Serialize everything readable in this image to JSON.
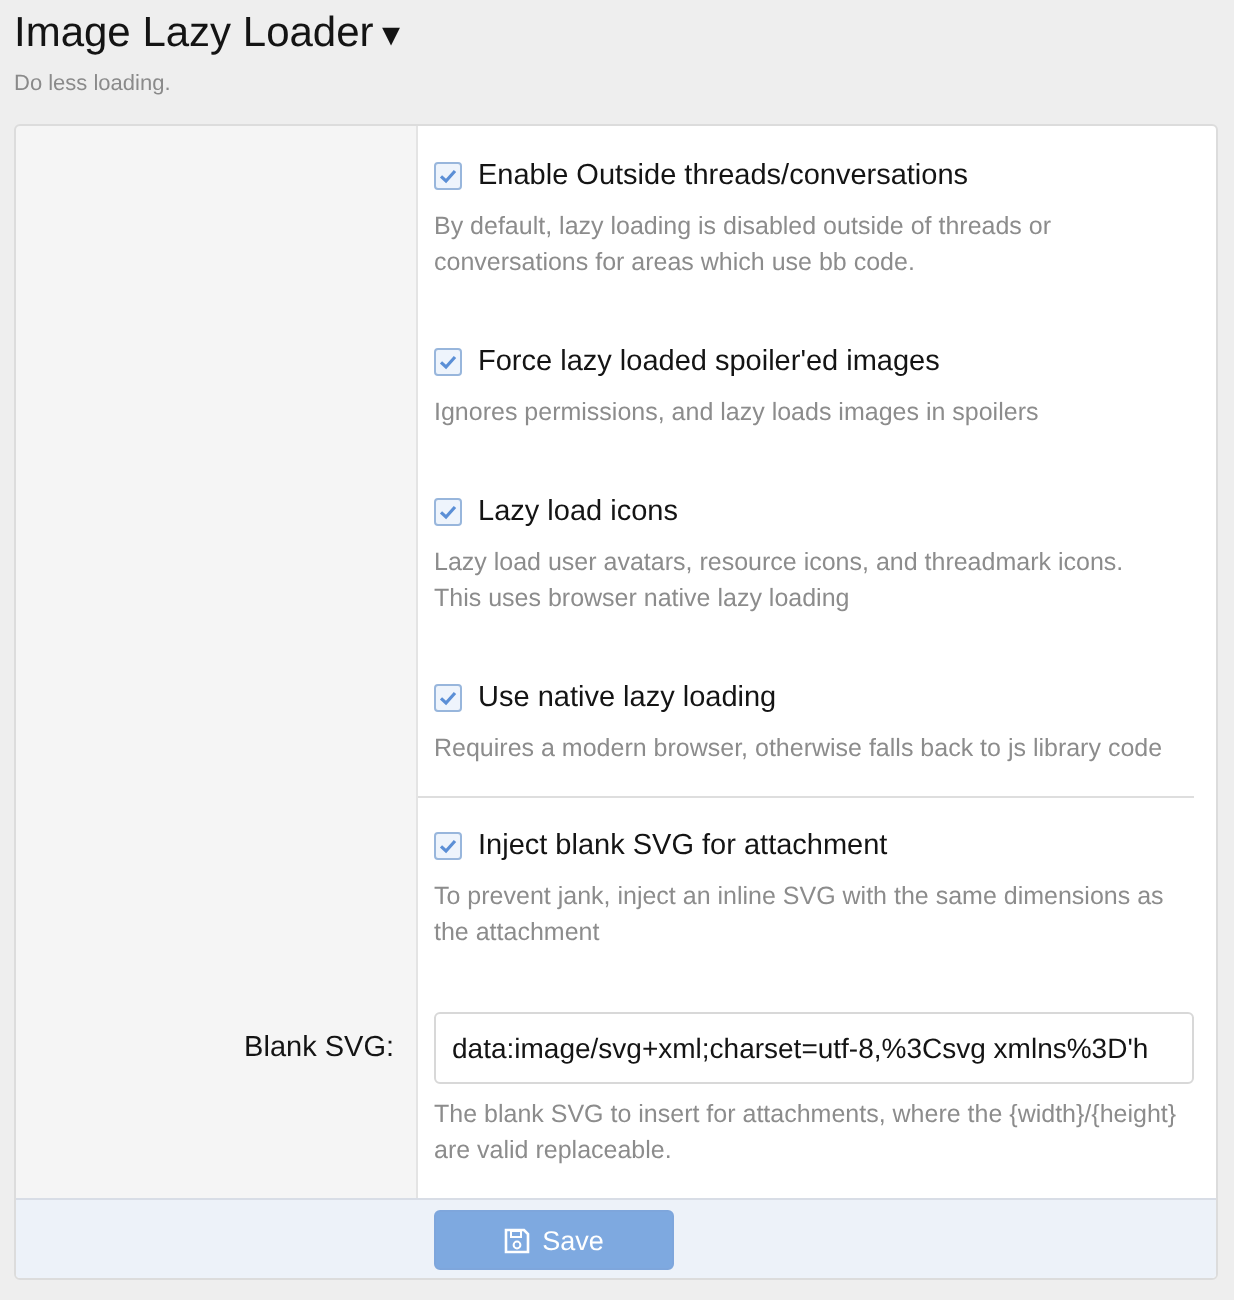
{
  "header": {
    "title": "Image Lazy Loader",
    "menu_caret": "▾",
    "description": "Do less loading."
  },
  "option_groups": [
    [
      {
        "kind": "checkbox",
        "label": "Enable Outside threads/conversations",
        "checked": true,
        "hint": "By default, lazy loading is disabled outside of threads or conversations for areas which use bb code."
      },
      {
        "kind": "checkbox",
        "label": "Force lazy loaded spoiler'ed images",
        "checked": true,
        "hint": "Ignores permissions, and lazy loads images in spoilers"
      },
      {
        "kind": "checkbox",
        "label": "Lazy load icons",
        "checked": true,
        "hint": "Lazy load user avatars, resource icons, and threadmark icons.\nThis uses browser native lazy loading"
      },
      {
        "kind": "checkbox",
        "label": "Use native lazy loading",
        "checked": true,
        "hint": "Requires a modern browser, otherwise falls back to js library code"
      }
    ],
    [
      {
        "kind": "checkbox",
        "label": "Inject blank SVG for attachment",
        "checked": true,
        "hint": "To prevent jank, inject an inline SVG with the same dimensions as the attachment"
      },
      {
        "kind": "text",
        "label": "Blank SVG:",
        "value": "data:image/svg+xml;charset=utf-8,%3Csvg xmlns%3D'h",
        "hint": "The blank SVG to insert for attachments, where the {width}/{height} are valid replaceable."
      }
    ]
  ],
  "save_button": {
    "label": "Save"
  }
}
